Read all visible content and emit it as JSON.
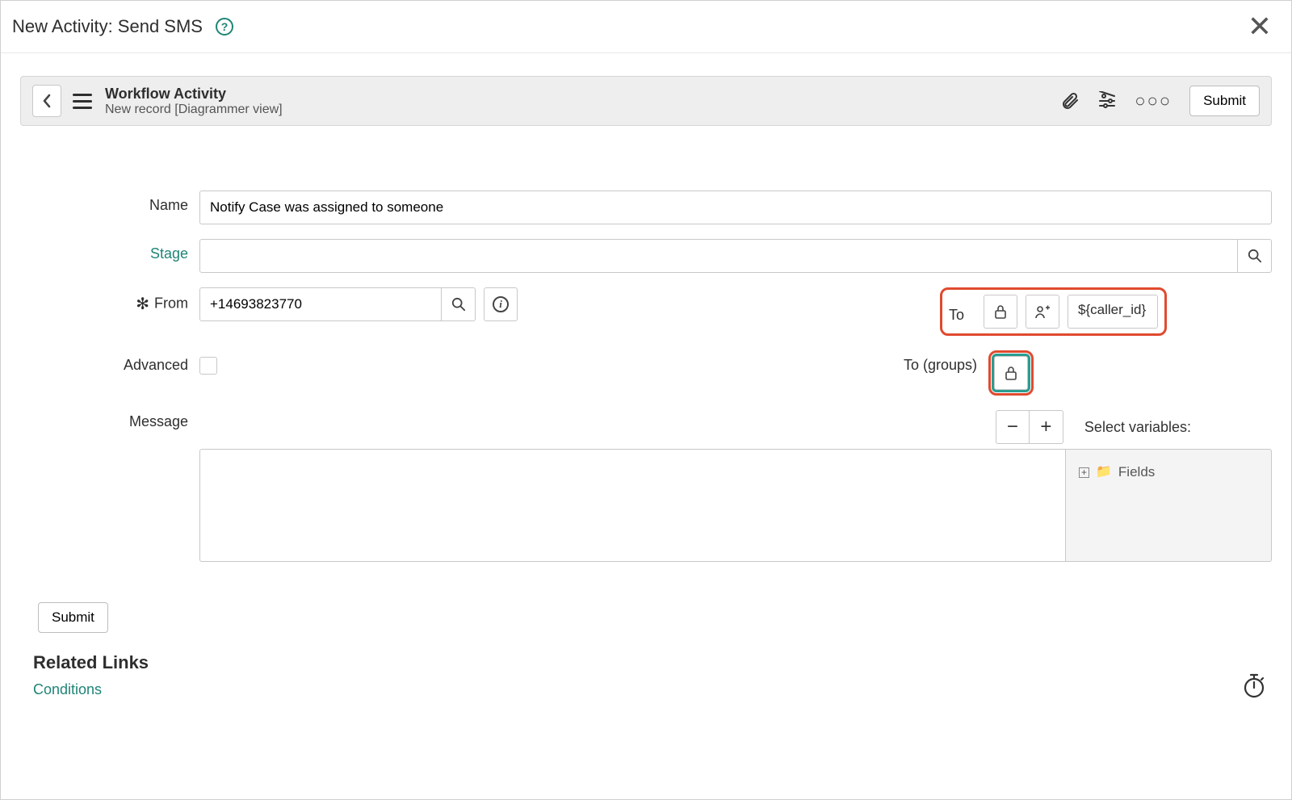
{
  "dialog": {
    "title": "New Activity: Send SMS"
  },
  "recordBar": {
    "heading": "Workflow Activity",
    "subheading": "New record [Diagrammer view]",
    "submit_label": "Submit"
  },
  "labels": {
    "name": "Name",
    "stage": "Stage",
    "from": "From",
    "to": "To",
    "to_groups": "To (groups)",
    "advanced": "Advanced",
    "message": "Message",
    "select_variables": "Select variables:",
    "fields_tree": "Fields",
    "related_links": "Related Links",
    "conditions": "Conditions"
  },
  "values": {
    "name": "Notify Case was assigned to someone",
    "stage": "",
    "from": "+14693823770",
    "to_value": "${caller_id}",
    "advanced_checked": false,
    "message": ""
  },
  "footer": {
    "submit_label": "Submit"
  }
}
